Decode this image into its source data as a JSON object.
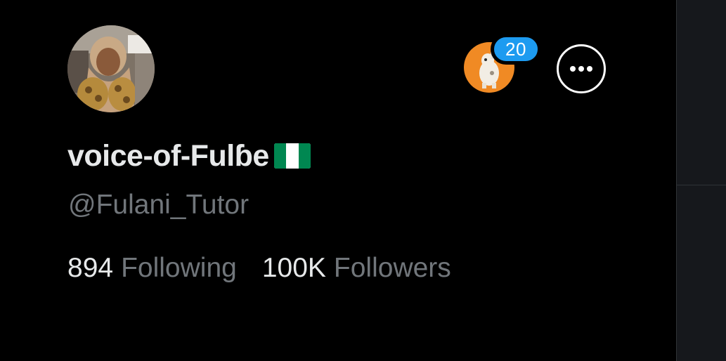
{
  "profile": {
    "display_name": "voice-of-Fulɓe",
    "name_emoji": "nigeria-flag-icon",
    "handle": "@Fulani_Tutor"
  },
  "stats": {
    "following_count": "894",
    "following_label": "Following",
    "followers_count": "100K",
    "followers_label": "Followers"
  },
  "account_switcher": {
    "badge_count": "20"
  },
  "colors": {
    "background": "#000000",
    "primary_text": "#e7e9ea",
    "secondary_text": "#71767b",
    "badge": "#1d9bf0",
    "mini_avatar_bg": "#f08a24",
    "flag_green": "#008751"
  }
}
